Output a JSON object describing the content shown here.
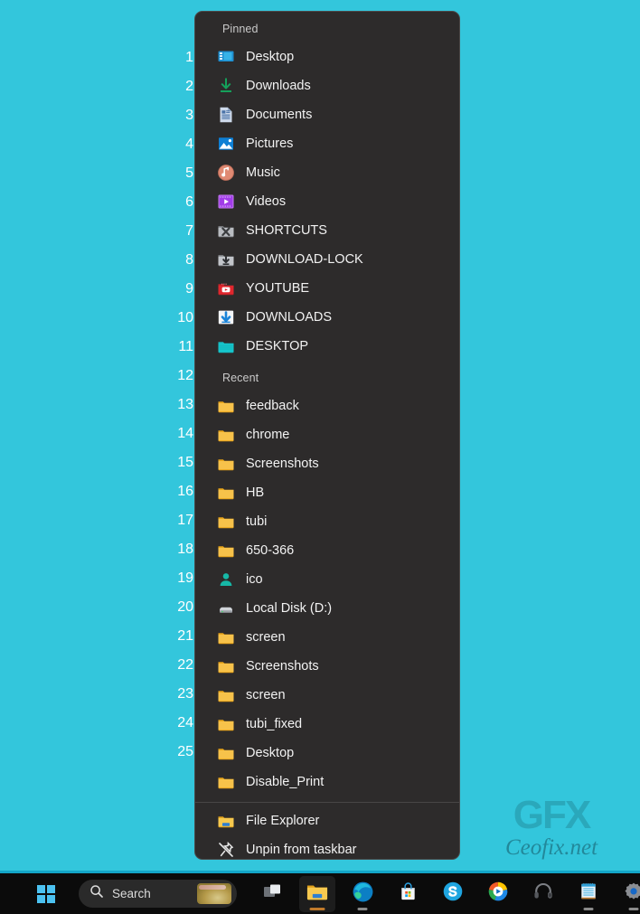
{
  "theme": {
    "desktop_bg": "#33c6dc",
    "menu_bg": "#2d2b2b",
    "menu_border": "#4a4848",
    "text": "#f2f2f2",
    "section_text": "#c9c9c9",
    "taskbar_bg": "#0b0b0b",
    "taskbar_accent": "#13a5c8",
    "number_color": "#ffffff",
    "folder_yellow": "#f7c24a"
  },
  "watermark": {
    "logo": "GFX",
    "site": "Ceofix.net"
  },
  "numbers": [
    "1",
    "2",
    "3",
    "4",
    "5",
    "6",
    "7",
    "8",
    "9",
    "10",
    "11",
    "12",
    "13",
    "14",
    "15",
    "16",
    "17",
    "18",
    "19",
    "20",
    "21",
    "22",
    "23",
    "24",
    "25"
  ],
  "jumplist": {
    "pinned": {
      "header": "Pinned",
      "items": [
        {
          "label": "Desktop",
          "icon": "desktop-monitor-icon"
        },
        {
          "label": "Downloads",
          "icon": "download-arrow-icon"
        },
        {
          "label": "Documents",
          "icon": "document-page-icon"
        },
        {
          "label": "Pictures",
          "icon": "picture-image-icon"
        },
        {
          "label": "Music",
          "icon": "music-note-icon"
        },
        {
          "label": "Videos",
          "icon": "video-play-icon"
        },
        {
          "label": "SHORTCUTS",
          "icon": "shortcuts-folder-icon"
        },
        {
          "label": "DOWNLOAD-LOCK",
          "icon": "download-lock-folder-icon"
        },
        {
          "label": "YOUTUBE",
          "icon": "youtube-folder-icon"
        },
        {
          "label": "DOWNLOADS",
          "icon": "downloads-blue-arrow-icon"
        },
        {
          "label": "DESKTOP",
          "icon": "teal-folder-icon"
        }
      ]
    },
    "recent": {
      "header": "Recent",
      "items": [
        {
          "label": "feedback",
          "icon": "folder-icon"
        },
        {
          "label": "chrome",
          "icon": "folder-icon"
        },
        {
          "label": "Screenshots",
          "icon": "folder-icon"
        },
        {
          "label": "HB",
          "icon": "folder-icon"
        },
        {
          "label": "tubi",
          "icon": "folder-icon"
        },
        {
          "label": "650-366",
          "icon": "folder-icon"
        },
        {
          "label": "ico",
          "icon": "user-person-icon"
        },
        {
          "label": "Local Disk  (D:)",
          "icon": "hard-disk-drive-icon"
        },
        {
          "label": "screen",
          "icon": "folder-icon"
        },
        {
          "label": "Screenshots",
          "icon": "folder-icon"
        },
        {
          "label": "screen",
          "icon": "folder-icon"
        },
        {
          "label": "tubi_fixed",
          "icon": "folder-icon"
        },
        {
          "label": "Desktop",
          "icon": "folder-icon"
        },
        {
          "label": "Disable_Print",
          "icon": "folder-icon"
        }
      ]
    },
    "actions": [
      {
        "label": "File Explorer",
        "icon": "file-explorer-icon"
      },
      {
        "label": "Unpin from taskbar",
        "icon": "unpin-icon"
      }
    ]
  },
  "taskbar": {
    "start": {
      "name": "Start",
      "icon": "windows-logo-icon"
    },
    "search": {
      "placeholder": "Search",
      "icon": "search-icon"
    },
    "apps": [
      {
        "name": "Task View",
        "icon": "task-view-icon",
        "active": false,
        "indicator": "none"
      },
      {
        "name": "File Explorer",
        "icon": "file-explorer-icon",
        "active": true,
        "indicator": "wide"
      },
      {
        "name": "Microsoft Edge",
        "icon": "edge-icon",
        "active": false,
        "indicator": "dot"
      },
      {
        "name": "Microsoft Store",
        "icon": "store-icon",
        "active": false,
        "indicator": "none"
      },
      {
        "name": "Skype",
        "icon": "skype-icon",
        "active": false,
        "indicator": "none"
      },
      {
        "name": "Media Player",
        "icon": "media-player-icon",
        "active": false,
        "indicator": "none"
      },
      {
        "name": "Headphones",
        "icon": "headphones-icon",
        "active": false,
        "indicator": "none"
      },
      {
        "name": "Notepad",
        "icon": "notepad-icon",
        "active": false,
        "indicator": "dot"
      },
      {
        "name": "Settings",
        "icon": "settings-gear-icon",
        "active": false,
        "indicator": "dot"
      }
    ]
  }
}
